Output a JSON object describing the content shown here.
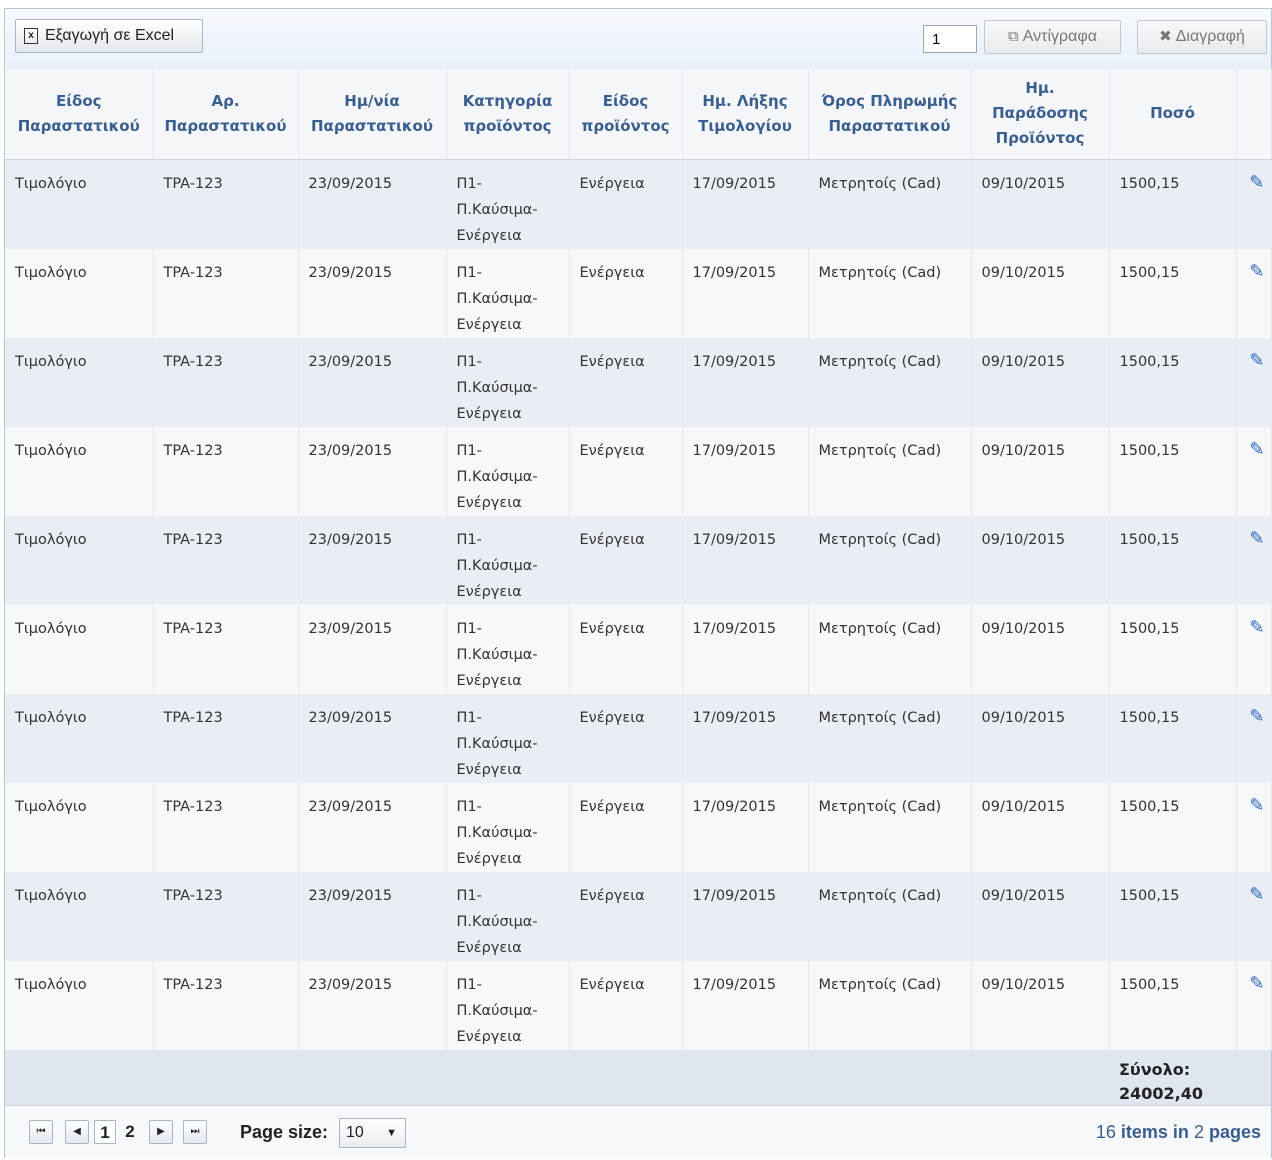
{
  "toolbar": {
    "export_label": "Εξαγωγή σε Excel",
    "copies_value": "1",
    "copy_label": "Αντίγραφα",
    "delete_label": "Διαγραφή"
  },
  "columns": [
    "Είδος Παραστατικού",
    "Αρ. Παραστατικού",
    "Ημ/νία Παραστατικού",
    "Κατηγορία προϊόντος",
    "Είδος προϊόντος",
    "Ημ. Λήξης Τιμολογίου",
    "Όρος Πληρωμής Παραστατικού",
    "Ημ. Παράδοσης Προϊόντος",
    "Ποσό"
  ],
  "rows": [
    {
      "type": "Τιμολόγιο",
      "number": "TPA-123",
      "date": "23/09/2015",
      "category": [
        "Π1-",
        "Π.Καύσιμα-",
        "Ενέργεια"
      ],
      "product": "Ενέργεια",
      "due": "17/09/2015",
      "terms": "Μετρητοίς (Cad)",
      "delivery": "09/10/2015",
      "amount": "1500,15"
    },
    {
      "type": "Τιμολόγιο",
      "number": "TPA-123",
      "date": "23/09/2015",
      "category": [
        "Π1-",
        "Π.Καύσιμα-",
        "Ενέργεια"
      ],
      "product": "Ενέργεια",
      "due": "17/09/2015",
      "terms": "Μετρητοίς (Cad)",
      "delivery": "09/10/2015",
      "amount": "1500,15"
    },
    {
      "type": "Τιμολόγιο",
      "number": "TPA-123",
      "date": "23/09/2015",
      "category": [
        "Π1-",
        "Π.Καύσιμα-",
        "Ενέργεια"
      ],
      "product": "Ενέργεια",
      "due": "17/09/2015",
      "terms": "Μετρητοίς (Cad)",
      "delivery": "09/10/2015",
      "amount": "1500,15"
    },
    {
      "type": "Τιμολόγιο",
      "number": "TPA-123",
      "date": "23/09/2015",
      "category": [
        "Π1-",
        "Π.Καύσιμα-",
        "Ενέργεια"
      ],
      "product": "Ενέργεια",
      "due": "17/09/2015",
      "terms": "Μετρητοίς (Cad)",
      "delivery": "09/10/2015",
      "amount": "1500,15"
    },
    {
      "type": "Τιμολόγιο",
      "number": "TPA-123",
      "date": "23/09/2015",
      "category": [
        "Π1-",
        "Π.Καύσιμα-",
        "Ενέργεια"
      ],
      "product": "Ενέργεια",
      "due": "17/09/2015",
      "terms": "Μετρητοίς (Cad)",
      "delivery": "09/10/2015",
      "amount": "1500,15"
    },
    {
      "type": "Τιμολόγιο",
      "number": "TPA-123",
      "date": "23/09/2015",
      "category": [
        "Π1-",
        "Π.Καύσιμα-",
        "Ενέργεια"
      ],
      "product": "Ενέργεια",
      "due": "17/09/2015",
      "terms": "Μετρητοίς (Cad)",
      "delivery": "09/10/2015",
      "amount": "1500,15"
    },
    {
      "type": "Τιμολόγιο",
      "number": "TPA-123",
      "date": "23/09/2015",
      "category": [
        "Π1-",
        "Π.Καύσιμα-",
        "Ενέργεια"
      ],
      "product": "Ενέργεια",
      "due": "17/09/2015",
      "terms": "Μετρητοίς (Cad)",
      "delivery": "09/10/2015",
      "amount": "1500,15"
    },
    {
      "type": "Τιμολόγιο",
      "number": "TPA-123",
      "date": "23/09/2015",
      "category": [
        "Π1-",
        "Π.Καύσιμα-",
        "Ενέργεια"
      ],
      "product": "Ενέργεια",
      "due": "17/09/2015",
      "terms": "Μετρητοίς (Cad)",
      "delivery": "09/10/2015",
      "amount": "1500,15"
    },
    {
      "type": "Τιμολόγιο",
      "number": "TPA-123",
      "date": "23/09/2015",
      "category": [
        "Π1-",
        "Π.Καύσιμα-",
        "Ενέργεια"
      ],
      "product": "Ενέργεια",
      "due": "17/09/2015",
      "terms": "Μετρητοίς (Cad)",
      "delivery": "09/10/2015",
      "amount": "1500,15"
    },
    {
      "type": "Τιμολόγιο",
      "number": "TPA-123",
      "date": "23/09/2015",
      "category": [
        "Π1-",
        "Π.Καύσιμα-",
        "Ενέργεια"
      ],
      "product": "Ενέργεια",
      "due": "17/09/2015",
      "terms": "Μετρητοίς (Cad)",
      "delivery": "09/10/2015",
      "amount": "1500,15"
    }
  ],
  "footer": {
    "total_label": "Σύνολο:",
    "total_value": "24002,40"
  },
  "pager": {
    "first": "H",
    "prev": "◀",
    "pages": [
      "1",
      "2"
    ],
    "current": "1",
    "next": "▶",
    "last": "H",
    "page_size_label": "Page size:",
    "page_size_value": "10",
    "info_count": "16",
    "info_items_in": "items in",
    "info_pages_count": "2",
    "info_pages": "pages"
  },
  "colors": {
    "header_text": "#3a5f8f",
    "row_alt": "#e9eef4",
    "edit_icon": "#2b66c4"
  }
}
